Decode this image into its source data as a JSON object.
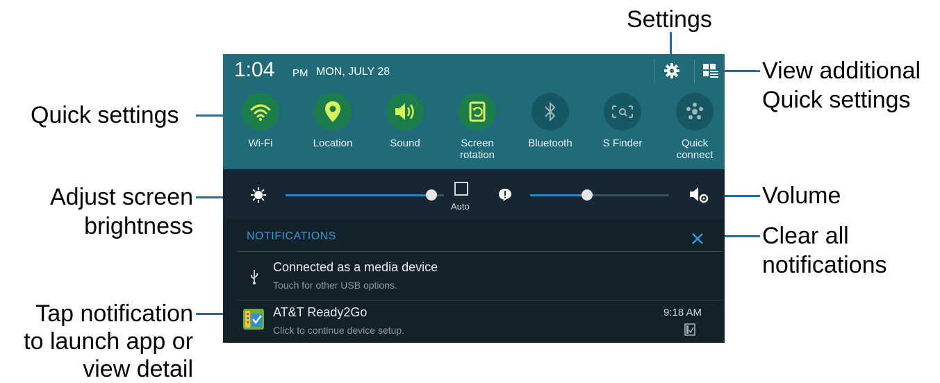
{
  "callouts": {
    "settings": "Settings",
    "view_additional_1": "View additional",
    "view_additional_2": "Quick settings",
    "quick_settings": "Quick settings",
    "adjust_1": "Adjust screen",
    "adjust_2": "brightness",
    "volume": "Volume",
    "clear_1": "Clear all",
    "clear_2": "notifications",
    "tap_1": "Tap notification",
    "tap_2": "to launch app or",
    "tap_3": "view detail"
  },
  "status": {
    "time": "1:04",
    "ampm": "PM",
    "date": "MON, JULY 28"
  },
  "quick_settings": [
    {
      "label1": "Wi-Fi",
      "label2": "",
      "icon": "wifi-icon",
      "on": true
    },
    {
      "label1": "Location",
      "label2": "",
      "icon": "location-icon",
      "on": true
    },
    {
      "label1": "Sound",
      "label2": "",
      "icon": "sound-icon",
      "on": true
    },
    {
      "label1": "Screen",
      "label2": "rotation",
      "icon": "screen-rotation-icon",
      "on": true
    },
    {
      "label1": "Bluetooth",
      "label2": "",
      "icon": "bluetooth-icon",
      "on": false
    },
    {
      "label1": "S Finder",
      "label2": "",
      "icon": "s-finder-icon",
      "on": false
    },
    {
      "label1": "Quick",
      "label2": "connect",
      "icon": "quick-connect-icon",
      "on": false
    }
  ],
  "brightness": {
    "auto_label": "Auto",
    "level": 0.92
  },
  "volume_level": 0.41,
  "notifications_header": "NOTIFICATIONS",
  "notifications": [
    {
      "title": "Connected as a media device",
      "subtitle": "Touch for other USB options.",
      "time": ""
    },
    {
      "title": "AT&T Ready2Go",
      "subtitle": "Click to continue device setup.",
      "time": "9:18 AM"
    }
  ],
  "colors": {
    "accent": "#1a6fb0",
    "panel": "#1f6b7a",
    "on_toggle": "#1c7d4a",
    "dark": "#13212b"
  }
}
